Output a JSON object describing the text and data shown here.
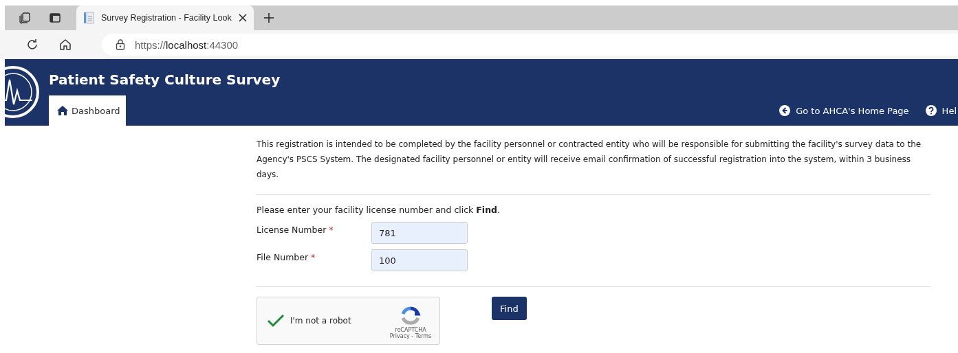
{
  "browser": {
    "tab": {
      "title": "Survey Registration - Facility Look",
      "selected": true
    },
    "address": {
      "scheme": "https://",
      "host": "localhost",
      "port": ":44300"
    }
  },
  "header": {
    "title": "Patient Safety Culture Survey",
    "nav": [
      {
        "label": "Dashboard",
        "selected": true
      }
    ],
    "links": [
      {
        "label": "Go to AHCA's Home Page",
        "kind": "back"
      },
      {
        "label": "Hel",
        "kind": "help"
      }
    ]
  },
  "intro": "This registration is intended to be completed by the facility personnel or contracted entity who will be responsible for submitting the facility's survey data to the Agency's PSCS System. The designated facility personnel or entity will receive email confirmation of successful registration into the system, within 3 business days.",
  "instruction": "Please enter your facility license number and click **Find**.",
  "fields": [
    {
      "label": "License Number",
      "required": "*",
      "value": "781"
    },
    {
      "label": "File Number",
      "required": "*",
      "value": "100"
    }
  ],
  "captcha": {
    "label": "I'm not a robot",
    "checked": true,
    "brand": "reCAPTCHA",
    "links": "Privacy - Terms"
  },
  "find_button": "Find"
}
